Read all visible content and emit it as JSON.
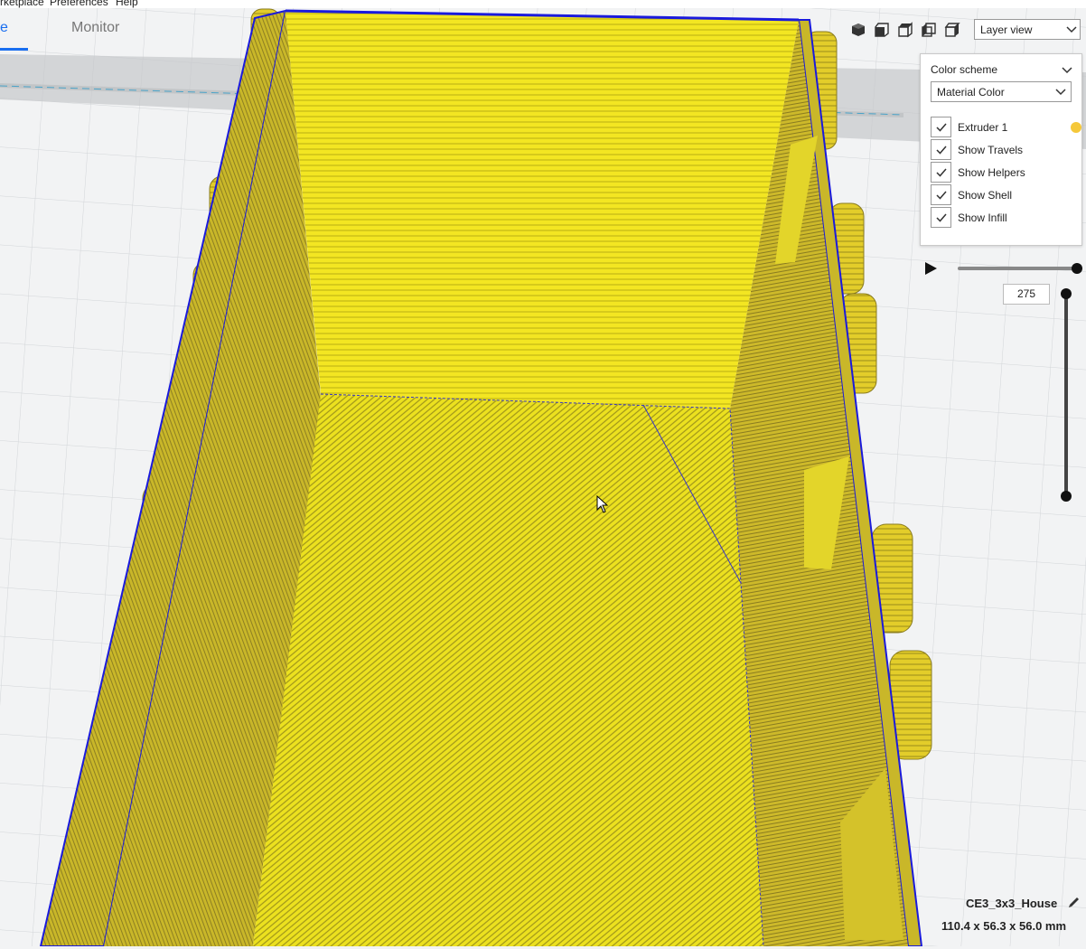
{
  "menu": {
    "items": [
      "rketplace",
      "Preferences",
      "Help"
    ]
  },
  "stage_tabs": [
    {
      "label": "e",
      "active": true
    },
    {
      "label": "Monitor",
      "active": false
    }
  ],
  "view_toolbar": {
    "icons": [
      "3d-view-icon",
      "front-view-icon",
      "top-view-icon",
      "left-view-icon",
      "right-view-icon"
    ],
    "view_mode": "Layer view"
  },
  "layer_panel": {
    "header": "Color scheme",
    "scheme_value": "Material Color",
    "checkboxes": [
      {
        "label": "Extruder 1",
        "checked": true,
        "swatch": "#f5c83a"
      },
      {
        "label": "Show Travels",
        "checked": true
      },
      {
        "label": "Show Helpers",
        "checked": true
      },
      {
        "label": "Show Shell",
        "checked": true
      },
      {
        "label": "Show Infill",
        "checked": true
      }
    ]
  },
  "layer_slider": {
    "current_layer": "275"
  },
  "object_info": {
    "name": "CE3_3x3_House",
    "dimensions": "110.4 x 56.3 x 56.0 mm"
  },
  "colors": {
    "accent": "#196ef0",
    "material_yellow": "#f0e41e",
    "travel_blue": "#1a1adc",
    "build_plate": "#f2f3f4"
  }
}
